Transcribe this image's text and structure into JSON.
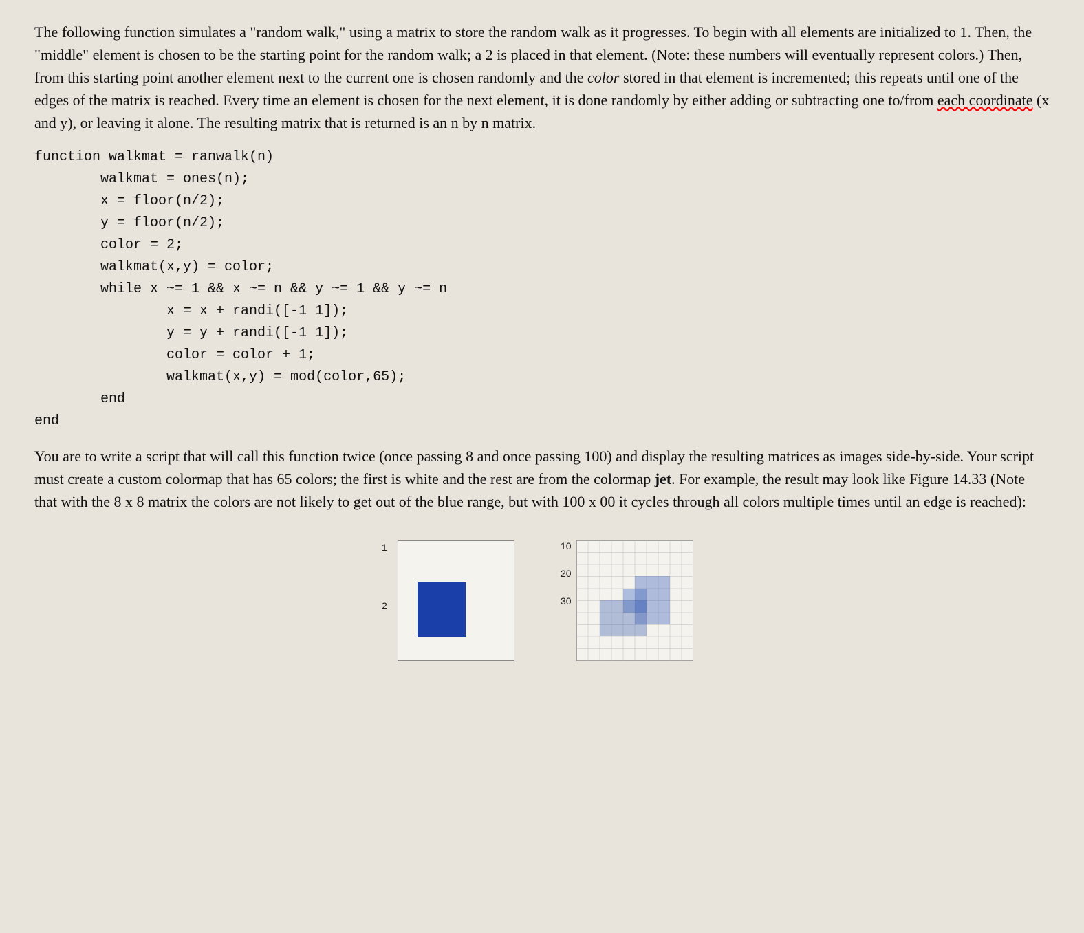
{
  "code": {
    "text": "function walkmat = ranwalk(n)\n        walkmat = ones(n);\n        x = floor(n/2);\n        y = floor(n/2);\n        color = 2;\n        walkmat(x,y) = color;\n        while x ~= 1 && x ~= n && y ~= 1 && y ~= n\n                x = x + randi([-1 1]);\n                y = y + randi([-1 1]);\n                color = color + 1;\n                walkmat(x,y) = mod(color,65);\n        end\nend"
  },
  "figures": {
    "fig1": {
      "ylabel1": "1",
      "ylabel2": "2"
    },
    "fig2": {
      "ylabel1": "10",
      "ylabel2": "20",
      "ylabel3": "30"
    }
  }
}
